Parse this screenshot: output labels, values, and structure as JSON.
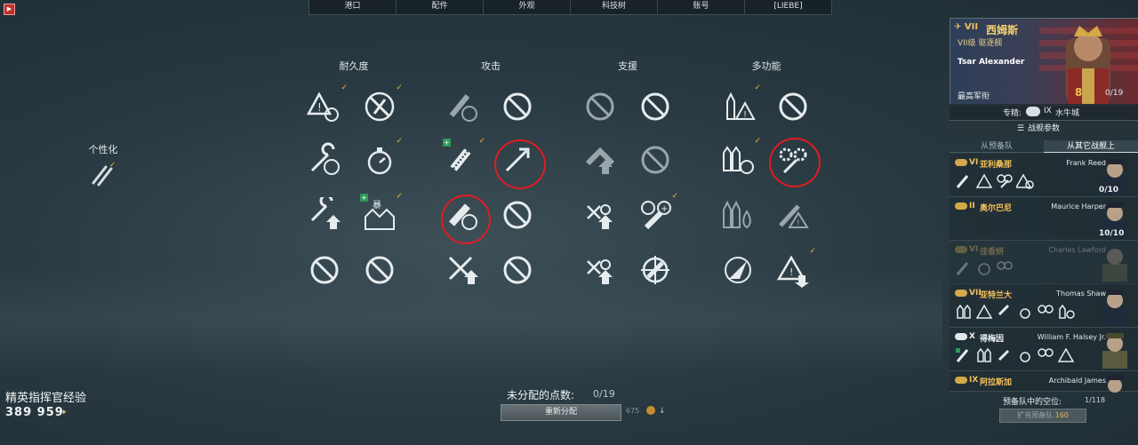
{
  "nav": {
    "tabs": [
      "港口",
      "配件",
      "外观",
      "科技树",
      "账号",
      "[LIEBE]"
    ]
  },
  "exit_icon": "exit-icon",
  "personalization": {
    "label": "个性化"
  },
  "skill_columns": [
    "耐久度",
    "攻击",
    "支援",
    "多功能"
  ],
  "experience": {
    "label": "精英指挥官经验",
    "value": "389 959"
  },
  "points": {
    "label": "未分配的点数:",
    "value": "0/19"
  },
  "redistribute": {
    "label": "重新分配",
    "cost": "675"
  },
  "commander": {
    "tier": "VII",
    "ship_name": "西姆斯",
    "ship_class": "VII级 驱逐舰",
    "name": "Tsar Alexander",
    "rank": "最高军衔",
    "level": "8",
    "points": "0/19",
    "spec_label": "专精:",
    "spec_tier": "IX",
    "spec_ship": "水牛城",
    "params_label": "战舰参数"
  },
  "reserve_tabs": [
    "从预备队",
    "从其它战舰上"
  ],
  "reserve": [
    {
      "tier": "VI",
      "ship": "亚利桑那",
      "name": "Frank Reed",
      "pts": "0/10",
      "color": "gold"
    },
    {
      "tier": "II",
      "ship": "奥尔巴尼",
      "name": "Maurice Harper",
      "pts": "10/10",
      "color": "gold"
    },
    {
      "tier": "VI",
      "ship": "佳香妍",
      "name": "Charles Lawford",
      "pts": "",
      "color": "gold"
    },
    {
      "tier": "VII",
      "ship": "亚特兰大",
      "name": "Thomas Shaw",
      "pts": "",
      "color": "gold"
    },
    {
      "tier": "X",
      "ship": "得梅因",
      "name": "William F. Halsey Jr.",
      "pts": "",
      "color": "white"
    },
    {
      "tier": "IX",
      "ship": "阿拉斯加",
      "name": "Archibald James",
      "pts": "",
      "color": "gold"
    }
  ],
  "reserve_space": {
    "label": "预备队中的空位:",
    "value": "1/118"
  },
  "expand": {
    "label": "扩充预备队",
    "cost": "160"
  }
}
